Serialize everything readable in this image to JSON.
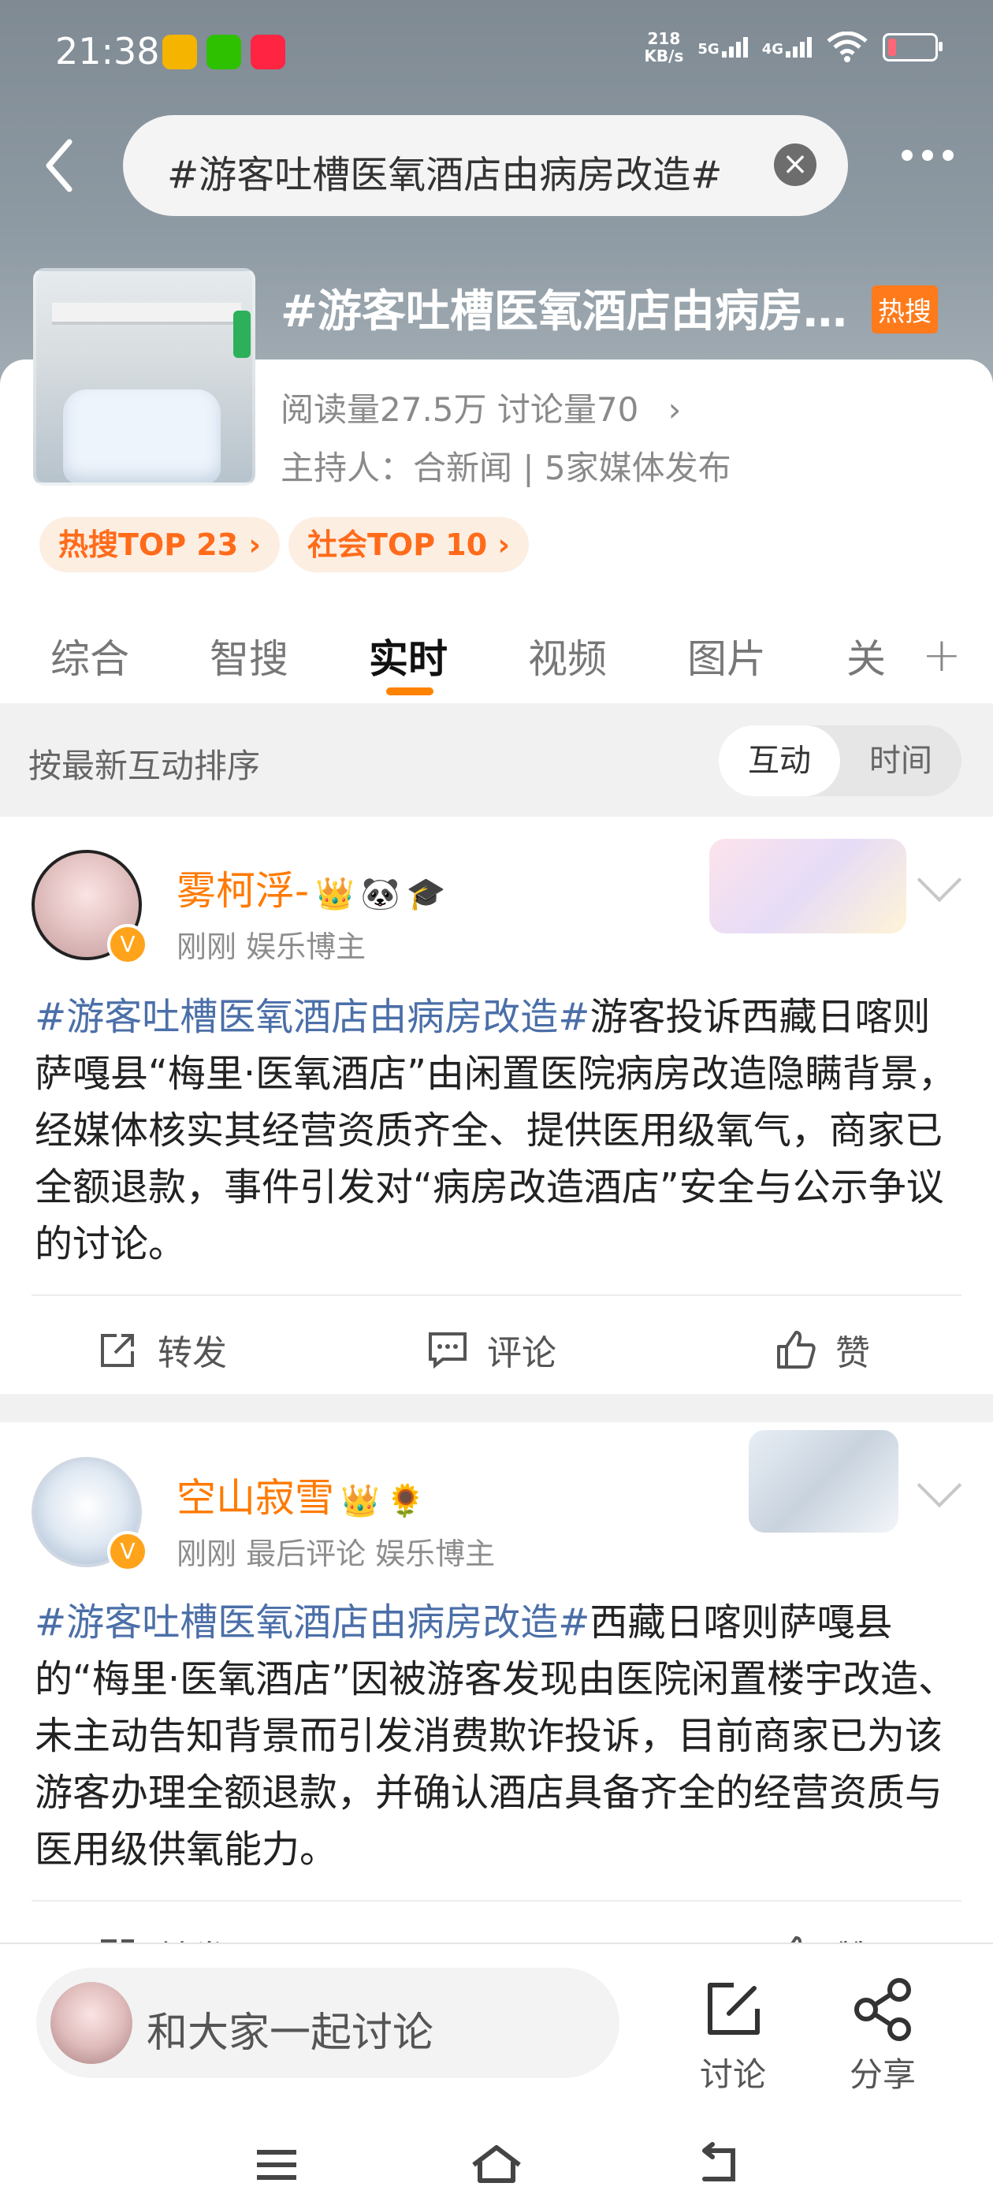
{
  "status_bar": {
    "time": "21:38",
    "net_speed_value": "218",
    "net_speed_unit": "KB/s",
    "signal1": "5G",
    "signal2": "4G"
  },
  "search": {
    "query": "#游客吐槽医氧酒店由病房改造#"
  },
  "topic": {
    "title": "#游客吐槽医氧酒店由病房改造#",
    "hot_badge": "热搜",
    "stats": "阅读量27.5万  讨论量70",
    "host": "主持人：合新闻 | 5家媒体发布",
    "pills": [
      "热搜TOP 23 ›",
      "社会TOP 10 ›"
    ]
  },
  "tabs": [
    "综合",
    "智搜",
    "实时",
    "视频",
    "图片",
    "关"
  ],
  "active_tab": "实时",
  "sort": {
    "label": "按最新互动排序",
    "options": [
      "互动",
      "时间"
    ],
    "selected": "互动"
  },
  "posts": [
    {
      "username": "雾柯浮-",
      "meta": "刚刚   娱乐博主",
      "tag": "#游客吐槽医氧酒店由病房改造#",
      "text": "游客投诉西藏日喀则萨嘎县“梅里·医氧酒店”由闲置医院病房改造隐瞒背景，经媒体核实其经营资质齐全、提供医用级氧气，商家已全额退款，事件引发对“病房改造酒店”安全与公示争议的讨论。",
      "actions": [
        "转发",
        "评论",
        "赞"
      ]
    },
    {
      "username": "空山寂雪",
      "meta": "刚刚 最后评论   娱乐博主",
      "tag": "#游客吐槽医氧酒店由病房改造#",
      "text": "西藏日喀则萨嘎县的“梅里·医氧酒店”因被游客发现由医院闲置楼宇改造、未主动告知背景而引发消费欺诈投诉，目前商家已为该游客办理全额退款，并确认酒店具备齐全的经营资质与医用级供氧能力。",
      "actions": [
        "转发",
        "评论",
        "赞"
      ]
    }
  ],
  "bottom": {
    "compose_placeholder": "和大家一起讨论",
    "discuss": "讨论",
    "share": "分享"
  }
}
